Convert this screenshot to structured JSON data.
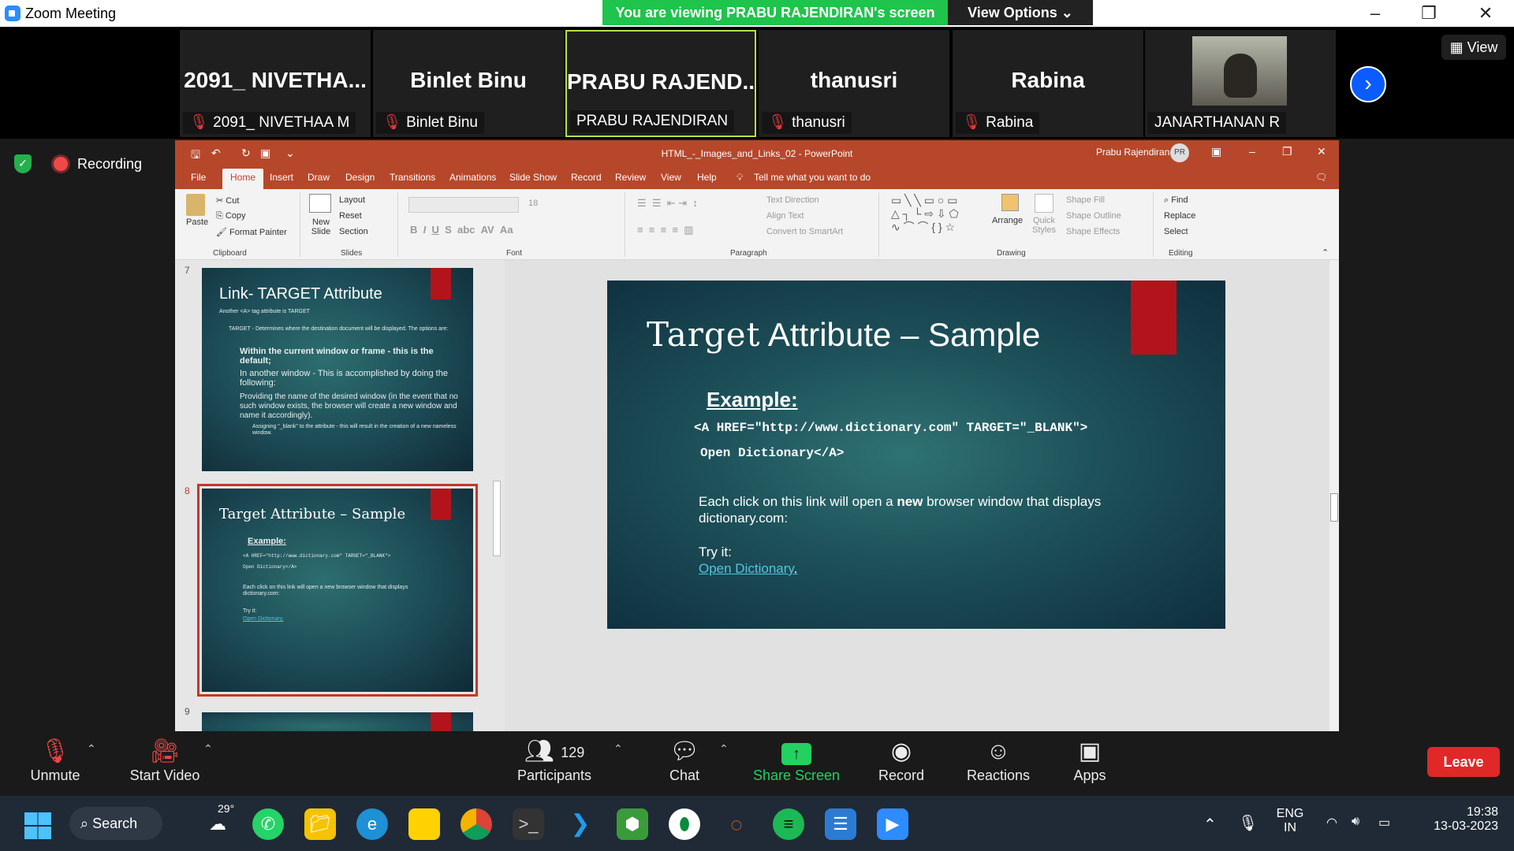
{
  "window": {
    "title": "Zoom Meeting"
  },
  "banner": {
    "viewing": "You are viewing PRABU RAJENDIRAN's screen",
    "view_options": "View Options ⌄"
  },
  "gallery": {
    "view_label": "View",
    "tiles": [
      {
        "big": "2091_ NIVETHA...",
        "name": "2091_ NIVETHAA M",
        "muted": true
      },
      {
        "big": "Binlet Binu",
        "name": "Binlet Binu",
        "muted": true
      },
      {
        "big": "PRABU RAJEND...",
        "name": "PRABU RAJENDIRAN",
        "muted": false
      },
      {
        "big": "thanusri",
        "name": "thanusri",
        "muted": true
      },
      {
        "big": "Rabina",
        "name": "Rabina",
        "muted": true
      },
      {
        "big": "",
        "name": "JANARTHANAN R",
        "muted": false
      }
    ]
  },
  "recording": {
    "label": "Recording"
  },
  "ppt": {
    "doc_title": "HTML_-_Images_and_Links_02  -  PowerPoint",
    "user": "Prabu Rajendiran",
    "user_initials": "PR",
    "tabs": [
      "File",
      "Home",
      "Insert",
      "Draw",
      "Design",
      "Transitions",
      "Animations",
      "Slide Show",
      "Record",
      "Review",
      "View",
      "Help"
    ],
    "tell_me": "Tell me what you want to do",
    "ribbon": {
      "paste": "Paste",
      "cut": "Cut",
      "copy": "Copy",
      "format_painter": "Format Painter",
      "clipboard": "Clipboard",
      "new_slide": "New Slide",
      "layout": "Layout",
      "reset": "Reset",
      "section": "Section",
      "slides": "Slides",
      "font_size": "18",
      "font": "Font",
      "text_direction": "Text Direction",
      "align_text": "Align Text",
      "convert_smartart": "Convert to SmartArt",
      "paragraph": "Paragraph",
      "arrange": "Arrange",
      "quick_styles": "Quick Styles",
      "shape_fill": "Shape Fill",
      "shape_outline": "Shape Outline",
      "shape_effects": "Shape Effects",
      "drawing": "Drawing",
      "find": "Find",
      "replace": "Replace",
      "select": "Select",
      "editing": "Editing"
    },
    "thumbs": [
      {
        "num": "7",
        "title": "Link- TARGET Attribute",
        "lines": [
          "Another <A> tag attribute is TARGET",
          "TARGET - Determines where the destination document will be displayed. The options are:",
          "Within the current window or frame - this is the default;",
          "In another window - This is accomplished by doing the following:",
          "Providing the name of the desired window (in the event that no such window exists, the browser will create a new window and name it accordingly).",
          "Assigning \"_blank\" to the attribute - this will result in the creation of a new nameless window."
        ]
      },
      {
        "num": "8",
        "title": "Target Attribute – Sample",
        "lines": [
          "Example:",
          "<A HREF=\"http://www.dictionary.com\" TARGET=\"_BLANK\">",
          "Open Dictionary</A>",
          "Each click on this link will open a new browser window that displays dictionary.com:",
          "Try it:",
          "Open Dictionary."
        ]
      },
      {
        "num": "9"
      }
    ],
    "slide": {
      "title_serif": "Target",
      "title_rest": "Attribute – Sample",
      "example": "Example:",
      "code1": "<A HREF=\"http://www.dictionary.com\" TARGET=\"_BLANK\">",
      "code2": "Open Dictionary</A>",
      "body_pre": "Each click on this link will open a ",
      "body_bold": "new",
      "body_post": " browser window that displays dictionary.com:",
      "try_it": "Try it:",
      "link": "Open Dictionary",
      "link_dot": "."
    }
  },
  "controls": {
    "unmute": "Unmute",
    "start_video": "Start Video",
    "participants": "Participants",
    "participants_count": "129",
    "chat": "Chat",
    "share_screen": "Share Screen",
    "record": "Record",
    "reactions": "Reactions",
    "apps": "Apps",
    "leave": "Leave"
  },
  "taskbar": {
    "search": "Search",
    "weather": "29°",
    "lang1": "ENG",
    "lang2": "IN",
    "time": "19:38",
    "date": "13-03-2023"
  }
}
